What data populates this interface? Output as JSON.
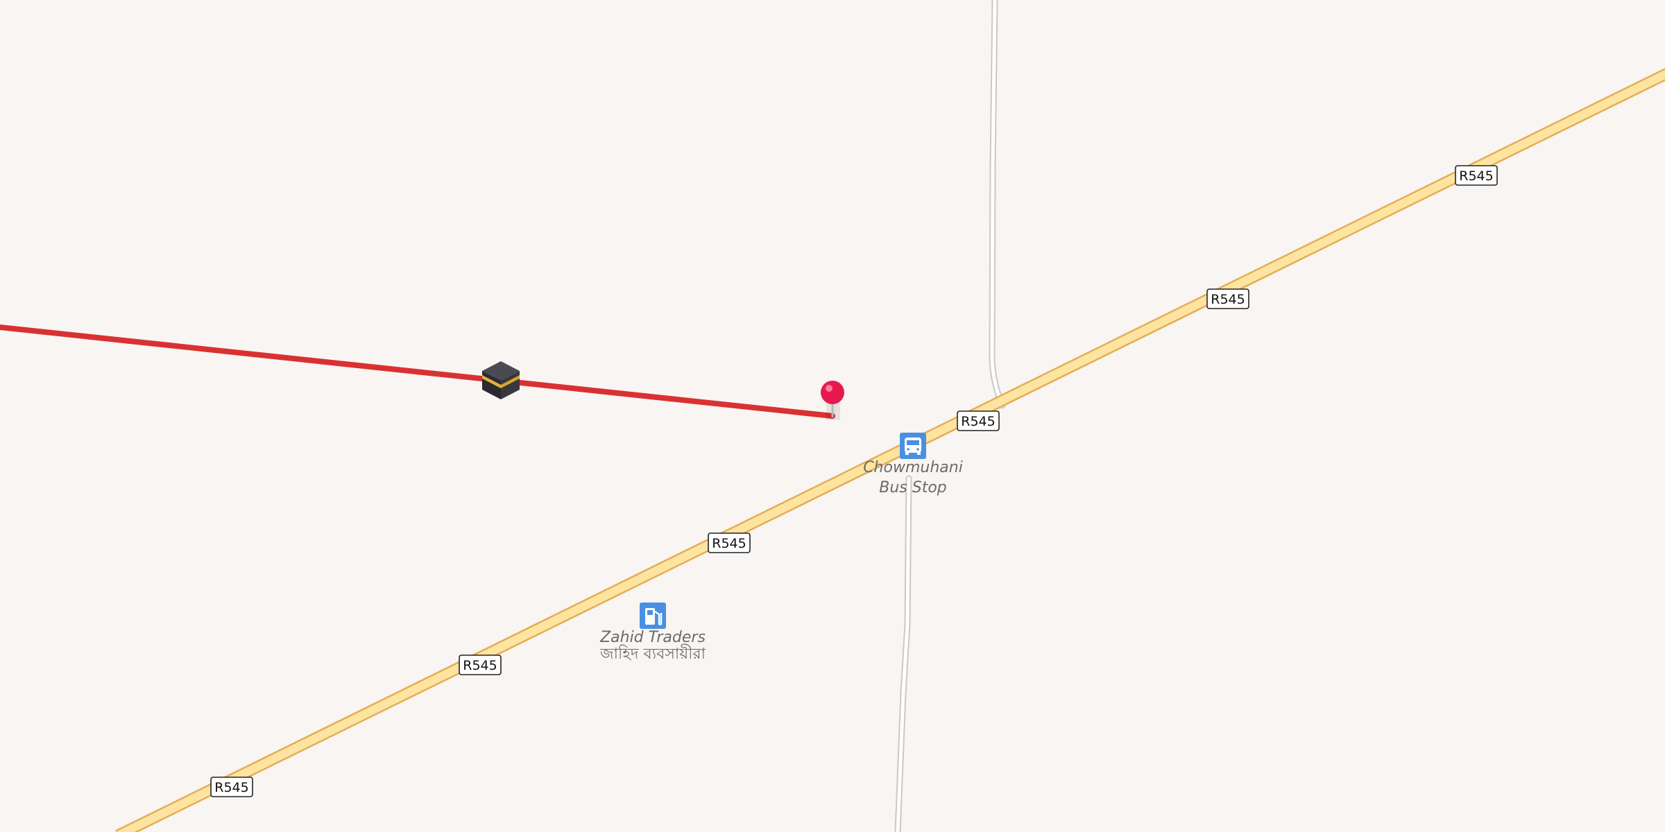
{
  "map": {
    "road_ref": "R545",
    "route_color": "#d93131",
    "road_fill_color": "#fde4a1",
    "road_casing_color": "#e5ad55",
    "minor_road_color": "#ffffff",
    "minor_road_casing_color": "#c9c9c9",
    "background_color": "#f8f5f2",
    "poi_icon_color": "#4a90e2"
  },
  "pois": {
    "bus_stop": {
      "icon": "bus-icon",
      "name_line1": "Chowmuhani",
      "name_line2": "Bus Stop"
    },
    "fuel": {
      "icon": "fuel-pump-icon",
      "name": "Zahid Traders",
      "name_local": "জাহিদ ব্যবসায়ীরা"
    },
    "kaaba": {
      "icon": "kaaba-icon"
    },
    "pin": {
      "icon": "map-pin-icon"
    }
  }
}
